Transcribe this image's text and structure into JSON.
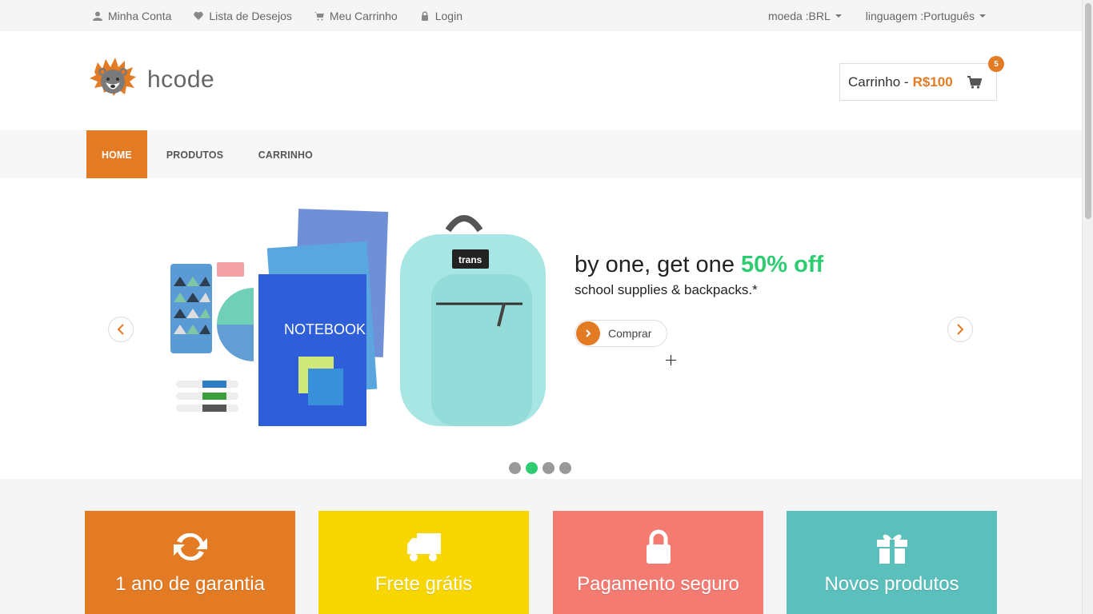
{
  "top_links": [
    {
      "label": "Minha Conta",
      "icon": "user-icon"
    },
    {
      "label": "Lista de Desejos",
      "icon": "heart-icon"
    },
    {
      "label": "Meu Carrinho",
      "icon": "cart-icon"
    },
    {
      "label": "Login",
      "icon": "lock-icon"
    }
  ],
  "currency_dropdown": "moeda :BRL",
  "language_dropdown": "linguagem :Português",
  "logo_text": "hcode",
  "cart": {
    "label": "Carrinho -",
    "total": "R$100",
    "count": "5"
  },
  "nav": [
    {
      "label": "HOME",
      "active": true
    },
    {
      "label": "PRODUTOS",
      "active": false
    },
    {
      "label": "CARRINHO",
      "active": false
    }
  ],
  "slide": {
    "title_start": "by one, get one",
    "title_highlight": "50% off",
    "subtitle": "school supplies & backpacks.*",
    "button": "Comprar",
    "backpack_patch": "trans",
    "notebook_text": "NOTEBOOK",
    "active_dot": 1,
    "dot_count": 4
  },
  "promos": [
    {
      "label": "1 ano de garantia",
      "icon": "refresh-icon",
      "color": "#e37b24"
    },
    {
      "label": "Frete grátis",
      "icon": "truck-icon",
      "color": "#f8d700"
    },
    {
      "label": "Pagamento seguro",
      "icon": "lock-icon",
      "color": "#f47b72"
    },
    {
      "label": "Novos produtos",
      "icon": "gift-icon",
      "color": "#5bbfbb"
    }
  ],
  "colors": {
    "accent": "#e37b24",
    "highlight": "#2ecc71"
  }
}
